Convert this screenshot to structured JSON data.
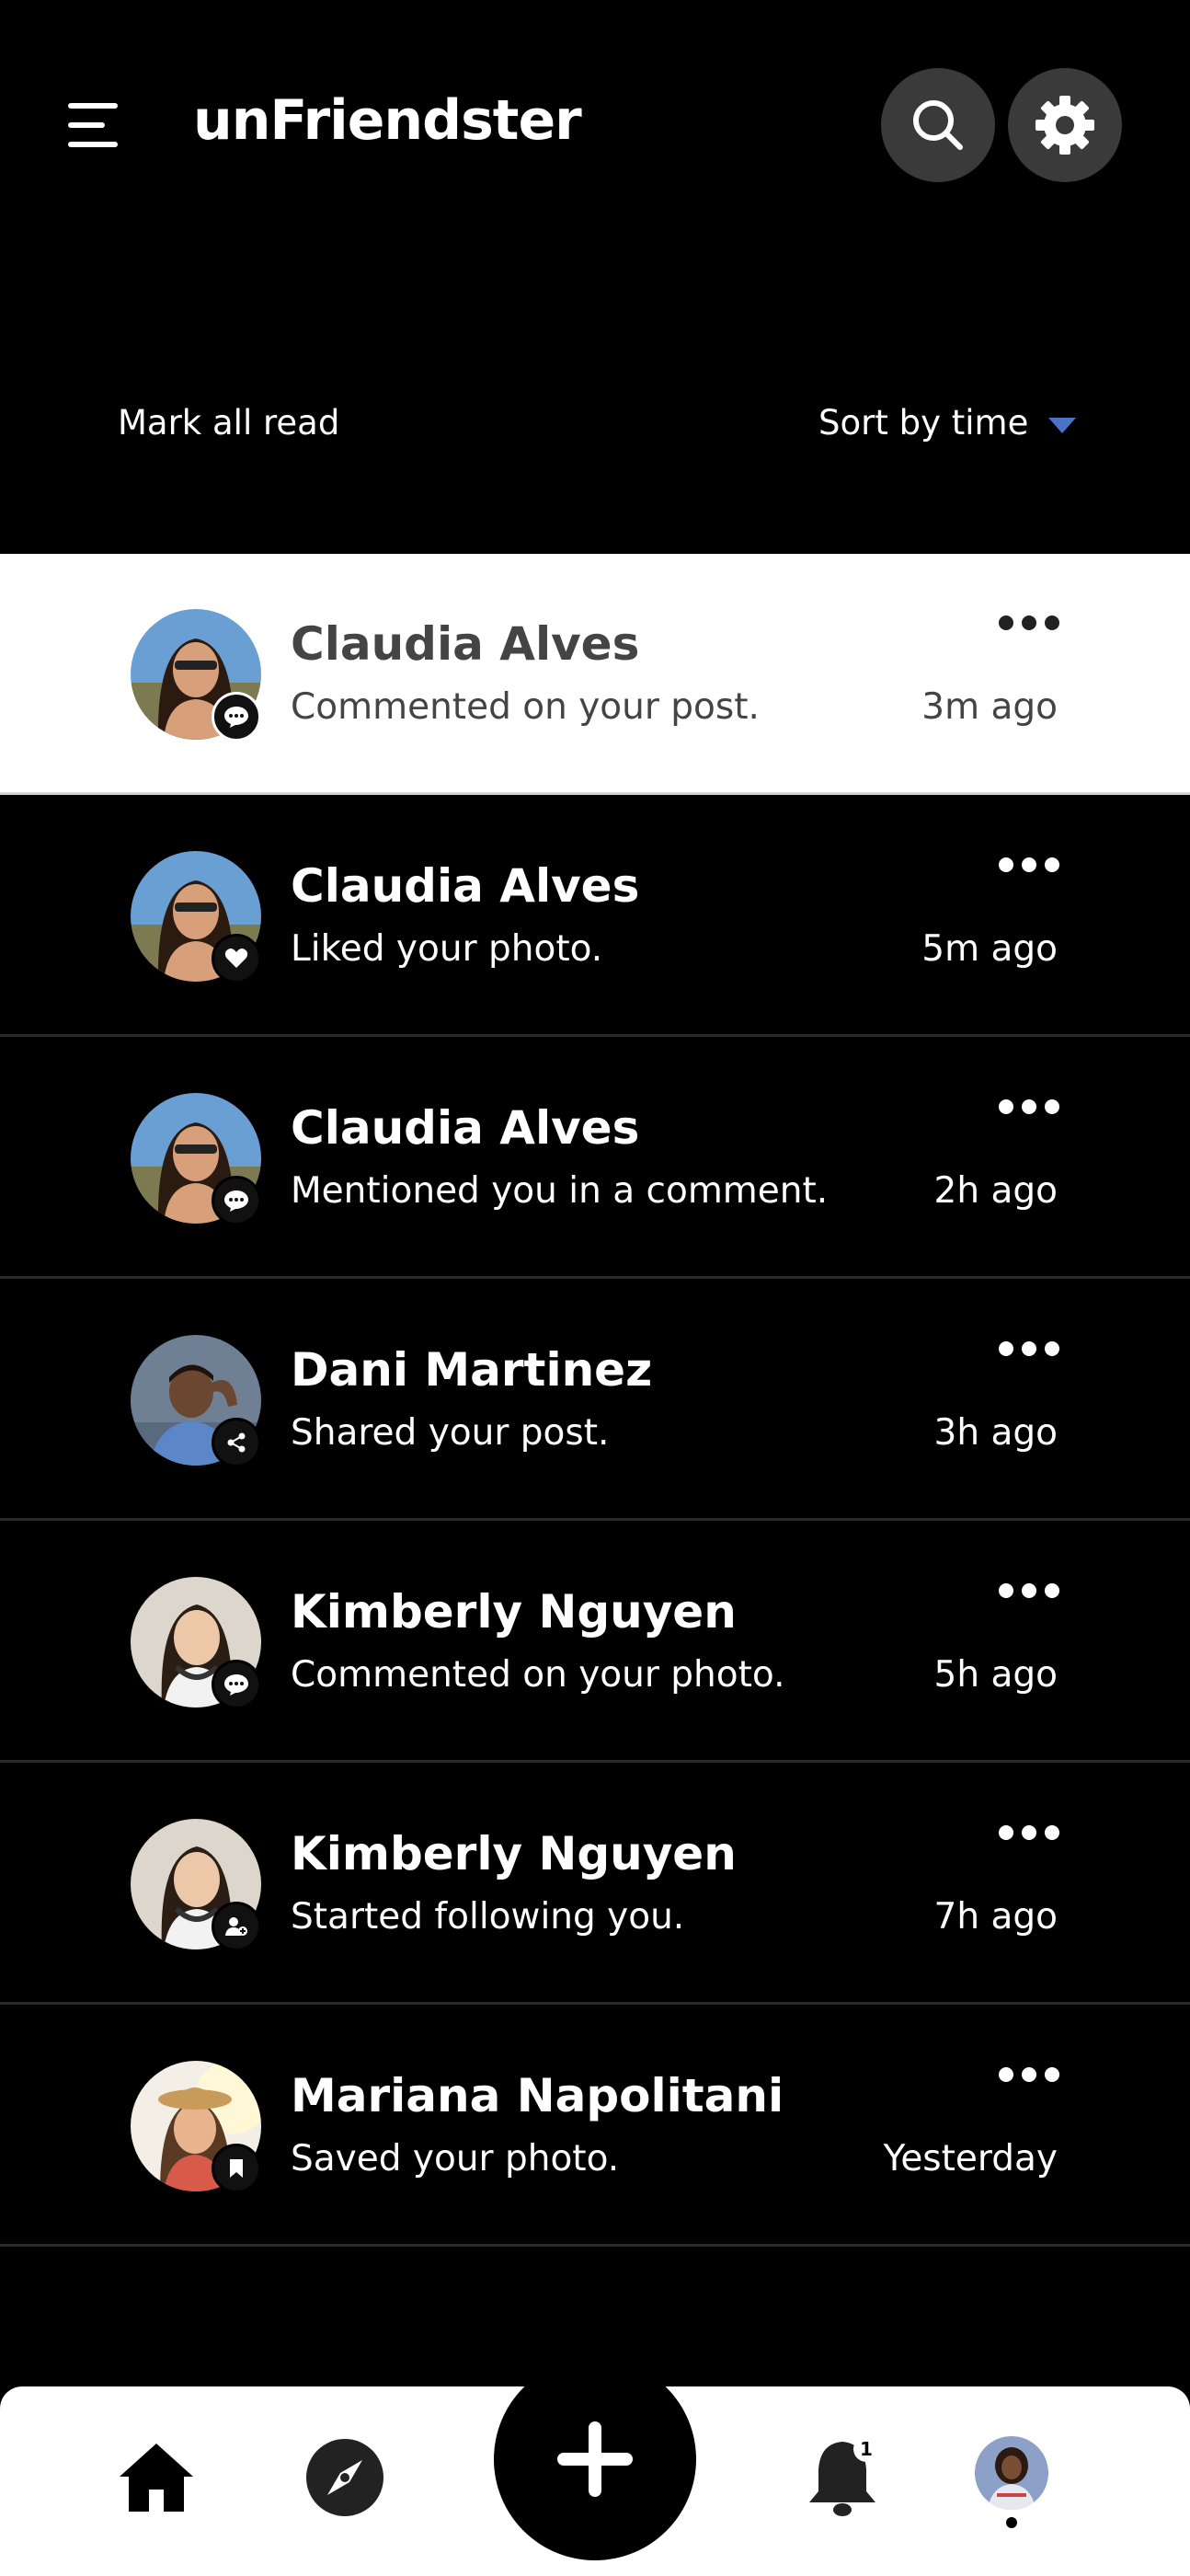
{
  "app": {
    "title": "unFriendster"
  },
  "header": {
    "menu_icon": "hamburger-icon",
    "search_icon": "search-icon",
    "settings_icon": "gear-icon"
  },
  "controls": {
    "mark_all_read": "Mark all read",
    "sort_label": "Sort by time",
    "sort_caret_color": "#4a73c6"
  },
  "notifications": [
    {
      "name": "Claudia Alves",
      "action": "Commented on your post.",
      "time": "3m ago",
      "badge_icon": "comment-icon",
      "highlighted": true
    },
    {
      "name": "Claudia Alves",
      "action": "Liked your photo.",
      "time": "5m ago",
      "badge_icon": "heart-icon",
      "highlighted": false
    },
    {
      "name": "Claudia Alves",
      "action": "Mentioned you in a comment.",
      "time": "2h ago",
      "badge_icon": "comment-icon",
      "highlighted": false
    },
    {
      "name": "Dani Martinez",
      "action": "Shared your post.",
      "time": "3h ago",
      "badge_icon": "share-icon",
      "highlighted": false
    },
    {
      "name": "Kimberly Nguyen",
      "action": "Commented on your photo.",
      "time": "5h ago",
      "badge_icon": "comment-icon",
      "highlighted": false
    },
    {
      "name": "Kimberly Nguyen",
      "action": "Started following you.",
      "time": "7h ago",
      "badge_icon": "follow-icon",
      "highlighted": false
    },
    {
      "name": "Mariana Napolitani",
      "action": "Saved your photo.",
      "time": "Yesterday",
      "badge_icon": "bookmark-icon",
      "highlighted": false
    }
  ],
  "bottom_nav": {
    "home_icon": "home-icon",
    "explore_icon": "compass-icon",
    "add_icon": "plus-icon",
    "notifications_icon": "bell-icon",
    "notifications_count": "1",
    "profile_icon": "avatar"
  }
}
